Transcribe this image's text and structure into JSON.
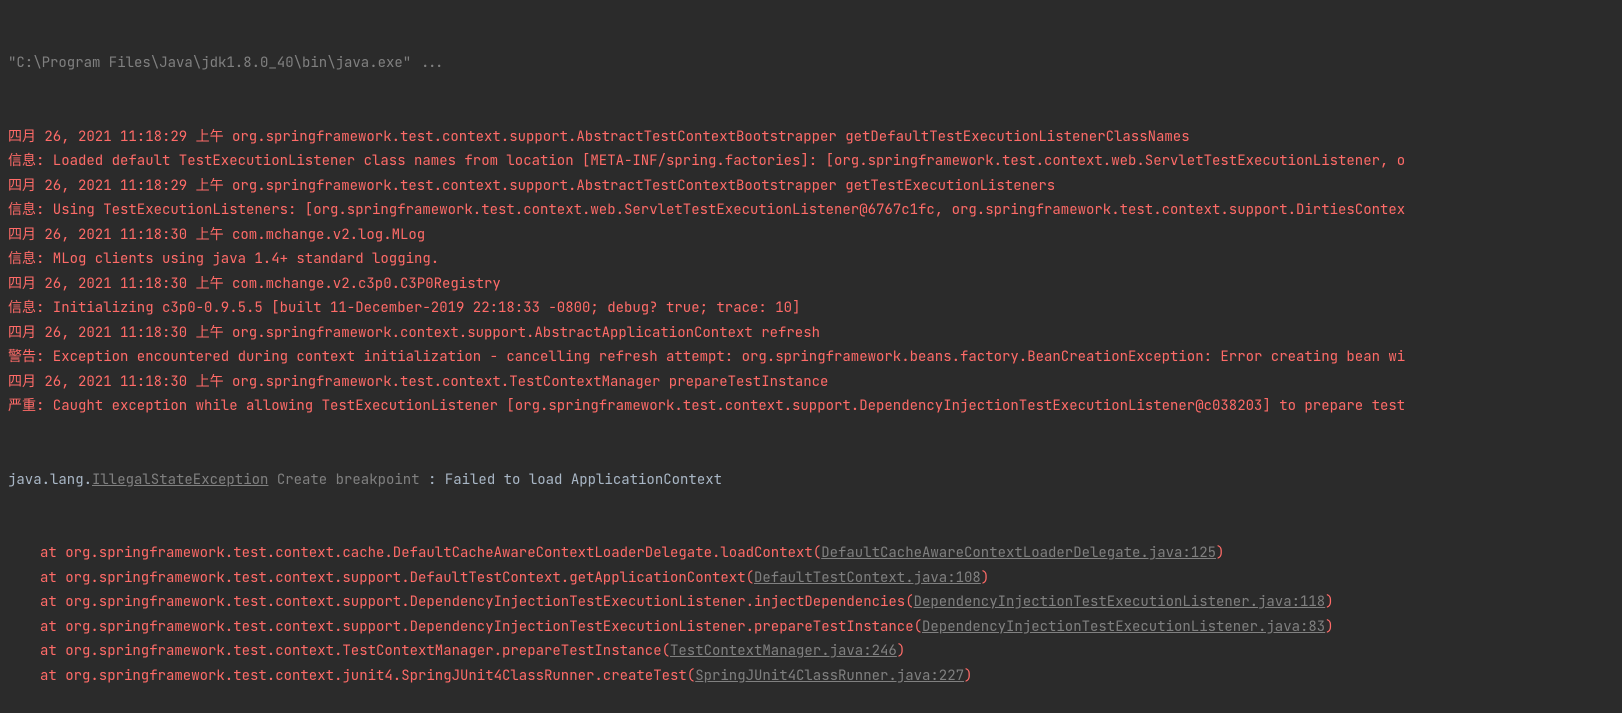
{
  "header": {
    "command": "\"C:\\Program Files\\Java\\jdk1.8.0_40\\bin\\java.exe\" ..."
  },
  "lines": [
    {
      "type": "log",
      "text": "四月 26, 2021 11:18:29 上午 org.springframework.test.context.support.AbstractTestContextBootstrapper getDefaultTestExecutionListenerClassNames"
    },
    {
      "type": "info",
      "text": "信息: Loaded default TestExecutionListener class names from location [META-INF/spring.factories]: [org.springframework.test.context.web.ServletTestExecutionListener, o"
    },
    {
      "type": "log",
      "text": "四月 26, 2021 11:18:29 上午 org.springframework.test.context.support.AbstractTestContextBootstrapper getTestExecutionListeners"
    },
    {
      "type": "info",
      "text": "信息: Using TestExecutionListeners: [org.springframework.test.context.web.ServletTestExecutionListener@6767c1fc, org.springframework.test.context.support.DirtiesContex"
    },
    {
      "type": "log",
      "text": "四月 26, 2021 11:18:30 上午 com.mchange.v2.log.MLog"
    },
    {
      "type": "info",
      "text": "信息: MLog clients using java 1.4+ standard logging."
    },
    {
      "type": "log",
      "text": "四月 26, 2021 11:18:30 上午 com.mchange.v2.c3p0.C3P0Registry"
    },
    {
      "type": "info",
      "text": "信息: Initializing c3p0-0.9.5.5 [built 11-December-2019 22:18:33 -0800; debug? true; trace: 10]"
    },
    {
      "type": "log",
      "text": "四月 26, 2021 11:18:30 上午 org.springframework.context.support.AbstractApplicationContext refresh"
    },
    {
      "type": "info",
      "text": "警告: Exception encountered during context initialization - cancelling refresh attempt: org.springframework.beans.factory.BeanCreationException: Error creating bean wi"
    },
    {
      "type": "log",
      "text": "四月 26, 2021 11:18:30 上午 org.springframework.test.context.TestContextManager prepareTestInstance"
    },
    {
      "type": "info",
      "text": "严重: Caught exception while allowing TestExecutionListener [org.springframework.test.context.support.DependencyInjectionTestExecutionListener@c038203] to prepare test"
    }
  ],
  "exception": {
    "prefix": "java.lang.",
    "class_name": "IllegalStateException",
    "breakpoint_label": "Create breakpoint",
    "message": " : Failed to load ApplicationContext"
  },
  "stack": [
    {
      "prefix": "at org.springframework.test.context.cache.DefaultCacheAwareContextLoaderDelegate.loadContext(",
      "link": "DefaultCacheAwareContextLoaderDelegate.java:125",
      "suffix": ")"
    },
    {
      "prefix": "at org.springframework.test.context.support.DefaultTestContext.getApplicationContext(",
      "link": "DefaultTestContext.java:108",
      "suffix": ")"
    },
    {
      "prefix": "at org.springframework.test.context.support.DependencyInjectionTestExecutionListener.injectDependencies(",
      "link": "DependencyInjectionTestExecutionListener.java:118",
      "suffix": ")"
    },
    {
      "prefix": "at org.springframework.test.context.support.DependencyInjectionTestExecutionListener.prepareTestInstance(",
      "link": "DependencyInjectionTestExecutionListener.java:83",
      "suffix": ")"
    },
    {
      "prefix": "at org.springframework.test.context.TestContextManager.prepareTestInstance(",
      "link": "TestContextManager.java:246",
      "suffix": ")"
    },
    {
      "prefix": "at org.springframework.test.context.junit4.SpringJUnit4ClassRunner.createTest(",
      "link": "SpringJUnit4ClassRunner.java:227",
      "suffix": ")"
    }
  ]
}
